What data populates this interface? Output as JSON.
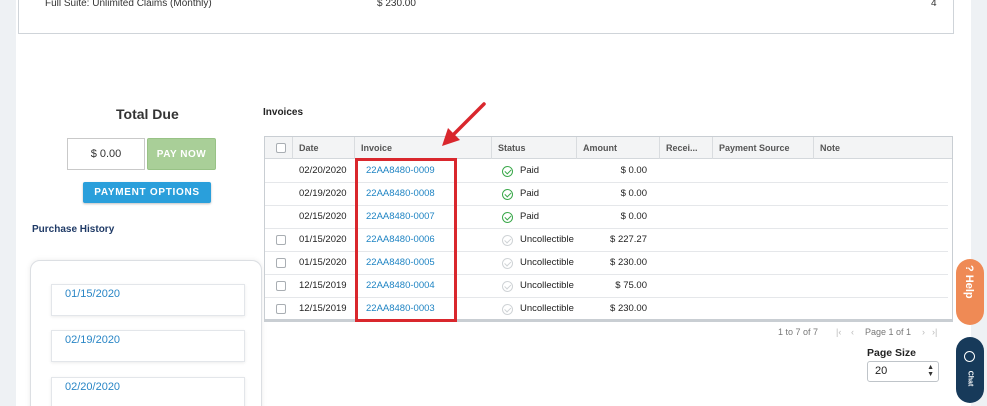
{
  "top_row": {
    "product": "Full Suite: Unlimited Claims (Monthly)",
    "price": "$ 230.00",
    "qty": "4"
  },
  "total_due": {
    "label": "Total Due",
    "amount": "$ 0.00",
    "pay_now_label": "PAY NOW",
    "payment_options_label": "PAYMENT OPTIONS"
  },
  "purchase_history": {
    "title": "Purchase History",
    "items": [
      "01/15/2020",
      "02/19/2020",
      "02/20/2020"
    ]
  },
  "invoices": {
    "title": "Invoices",
    "columns": [
      "Date",
      "Invoice",
      "Status",
      "Amount",
      "Recei...",
      "Payment Source",
      "Note"
    ],
    "rows": [
      {
        "date": "02/20/2020",
        "invoice": "22AA8480-0009",
        "status": "Paid",
        "amount": "$ 0.00",
        "selectable": false
      },
      {
        "date": "02/19/2020",
        "invoice": "22AA8480-0008",
        "status": "Paid",
        "amount": "$ 0.00",
        "selectable": false
      },
      {
        "date": "02/15/2020",
        "invoice": "22AA8480-0007",
        "status": "Paid",
        "amount": "$ 0.00",
        "selectable": false
      },
      {
        "date": "01/15/2020",
        "invoice": "22AA8480-0006",
        "status": "Uncollectible",
        "amount": "$ 227.27",
        "selectable": true
      },
      {
        "date": "01/15/2020",
        "invoice": "22AA8480-0005",
        "status": "Uncollectible",
        "amount": "$ 230.00",
        "selectable": true
      },
      {
        "date": "12/15/2019",
        "invoice": "22AA8480-0004",
        "status": "Uncollectible",
        "amount": "$ 75.00",
        "selectable": true
      },
      {
        "date": "12/15/2019",
        "invoice": "22AA8480-0003",
        "status": "Uncollectible",
        "amount": "$ 230.00",
        "selectable": true
      }
    ]
  },
  "pager": {
    "range": "1 to 7 of 7",
    "page": "Page 1 of 1"
  },
  "page_size": {
    "label": "Page Size",
    "value": "20"
  },
  "widgets": {
    "help_label": "? Help",
    "chat_label": "Chat"
  },
  "colors": {
    "accent": "#2a9fdb",
    "link": "#1f84c3",
    "pay_now": "#a9cf98",
    "highlight": "#d9272d",
    "help": "#ef8a55",
    "chat": "#173a5a"
  }
}
